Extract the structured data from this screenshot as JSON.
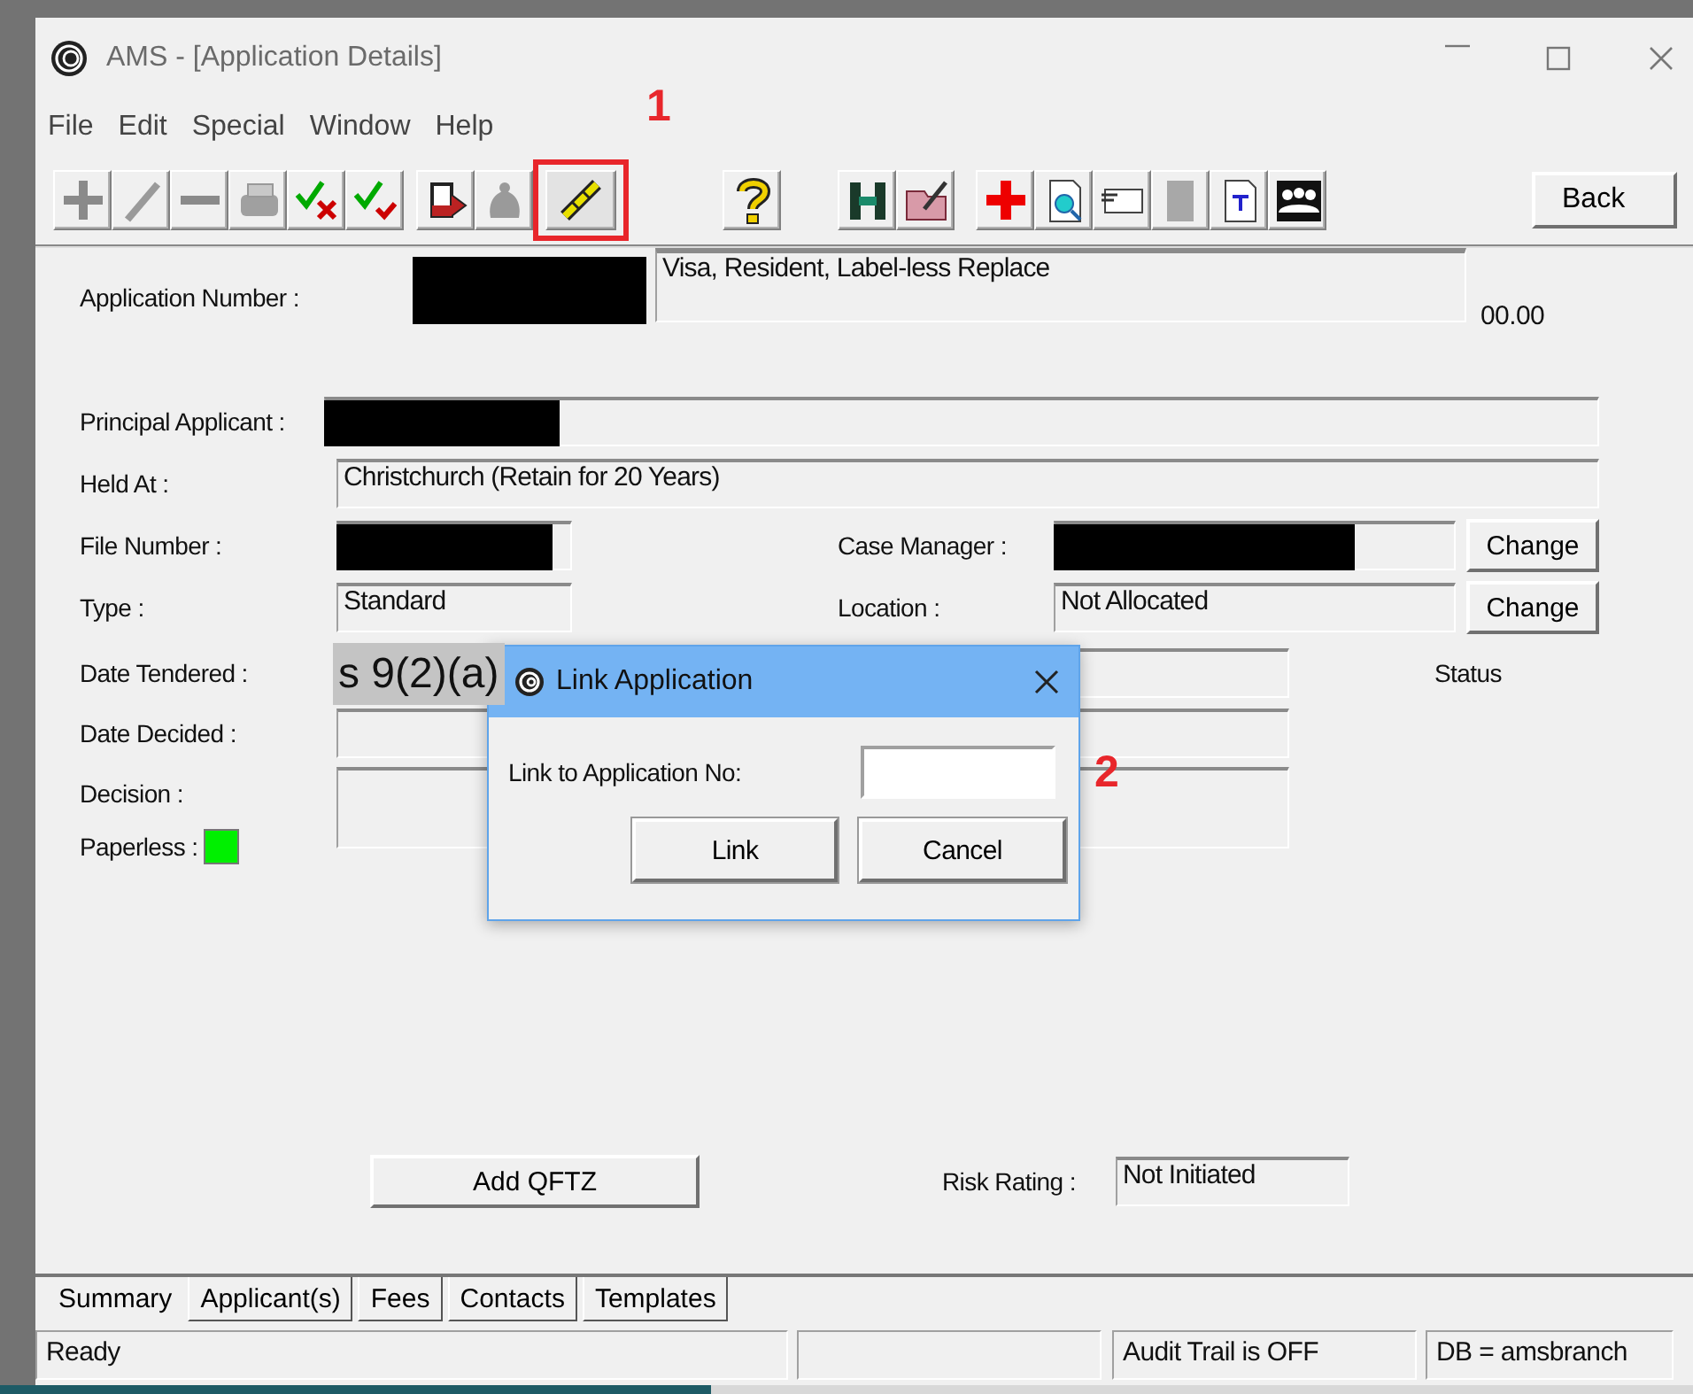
{
  "window": {
    "title": "AMS - [Application Details]"
  },
  "menu": [
    "File",
    "Edit",
    "Special",
    "Window",
    "Help"
  ],
  "back_button": "Back",
  "application": {
    "label": "Application Number :",
    "redacted": true,
    "description": "Visa, Resident, Label-less Replace",
    "amount": "00.00"
  },
  "principal_applicant": {
    "label": "Principal Applicant :",
    "redacted": true
  },
  "held_at": {
    "label": "Held At :",
    "value": "Christchurch (Retain for 20 Years)"
  },
  "file_number": {
    "label": "File Number :",
    "redacted": true
  },
  "case_manager": {
    "label": "Case Manager :",
    "redacted": true,
    "button": "Change"
  },
  "type": {
    "label": "Type :",
    "value": "Standard"
  },
  "location": {
    "label": "Location :",
    "value": "Not Allocated",
    "button": "Change"
  },
  "date_tendered": {
    "label": "Date Tendered :",
    "redaction_note": "s 9(2)(a)"
  },
  "status": {
    "label": "Status"
  },
  "date_decided": {
    "label": "Date Decided :"
  },
  "decision": {
    "label": "Decision :"
  },
  "paperless": {
    "label": "Paperless :",
    "on": true
  },
  "add_qftz_button": "Add QFTZ",
  "risk_rating": {
    "label": "Risk Rating :",
    "value": "Not Initiated"
  },
  "tabs": [
    {
      "label": "Summary",
      "selected": true
    },
    {
      "label": "Applicant(s)",
      "selected": false
    },
    {
      "label": "Fees",
      "selected": false
    },
    {
      "label": "Contacts",
      "selected": false
    },
    {
      "label": "Templates",
      "selected": false
    }
  ],
  "status_bar": {
    "message": "Ready",
    "audit": "Audit Trail is OFF",
    "database": "DB = amsbranch"
  },
  "dialog": {
    "title": "Link Application",
    "field_label": "Link to Application No:",
    "buttons": [
      "Link",
      "Cancel"
    ]
  },
  "annotations": [
    {
      "label": "1"
    },
    {
      "label": "2"
    }
  ]
}
